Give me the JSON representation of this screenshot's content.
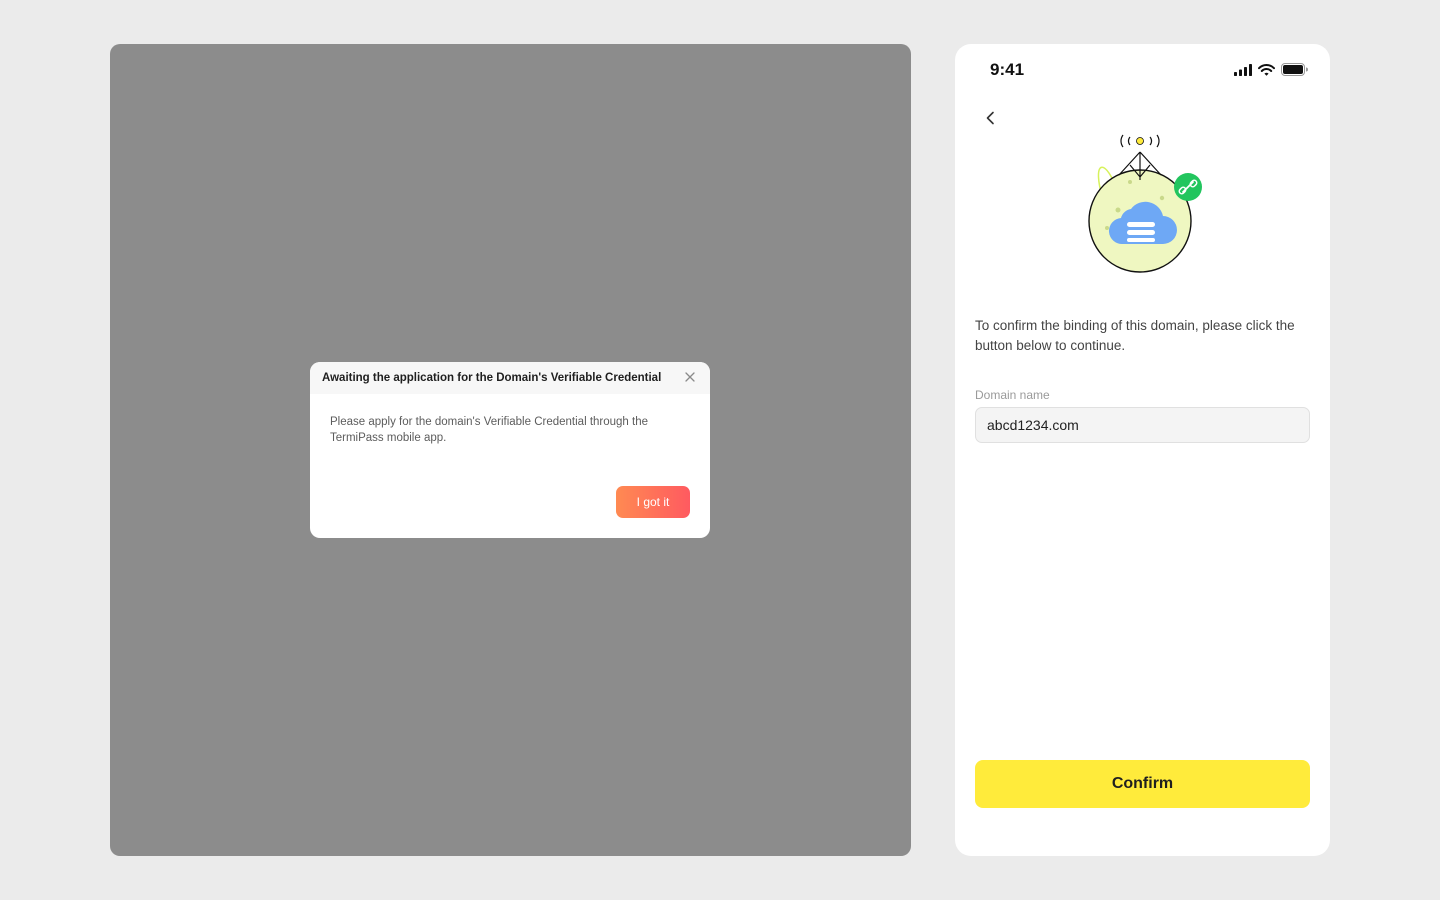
{
  "dialog": {
    "title": "Awaiting the application for the Domain's Verifiable Credential",
    "message": "Please apply for the domain's Verifiable Credential through the TermiPass mobile app.",
    "button_label": "I got it",
    "close_icon": "close-icon"
  },
  "phone": {
    "status_time": "9:41",
    "status_icons": [
      "cellular-signal-icon",
      "wifi-icon",
      "battery-icon"
    ],
    "back_icon": "chevron-left-icon",
    "illustration_icon": "domain-cloud-globe-illustration",
    "intro_text": "To confirm the binding of this domain, please click the button below to continue.",
    "field_label": "Domain name",
    "field_value": "abcd1234.com",
    "confirm_label": "Confirm"
  },
  "colors": {
    "desktop_background": "#8c8c8c",
    "page_background": "#ebebeb",
    "dialog_button_gradient": [
      "#ff8a52",
      "#ff5a60"
    ],
    "confirm_button": "#ffeb3b",
    "link_badge": "#22c55e"
  }
}
